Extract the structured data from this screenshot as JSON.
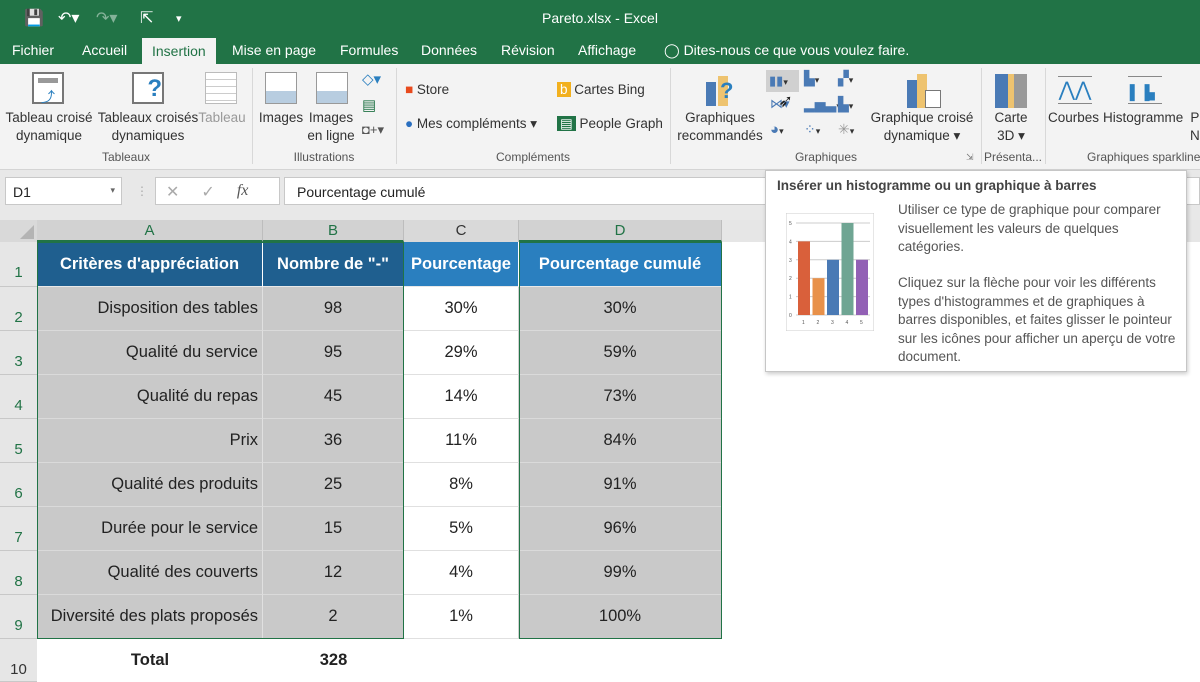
{
  "window": {
    "title": "Pareto.xlsx - Excel"
  },
  "quick_access": {
    "save": "save-icon",
    "undo": "undo-icon",
    "redo": "redo-icon",
    "pointer": "pointer-icon",
    "customize": "▾"
  },
  "tabs": [
    {
      "label": "Fichier"
    },
    {
      "label": "Accueil"
    },
    {
      "label": "Insertion",
      "active": true
    },
    {
      "label": "Mise en page"
    },
    {
      "label": "Formules"
    },
    {
      "label": "Données"
    },
    {
      "label": "Révision"
    },
    {
      "label": "Affichage"
    }
  ],
  "tell_me": "Dites-nous ce que vous voulez faire.",
  "ribbon": {
    "tableaux": {
      "group": "Tableaux",
      "b1": [
        "Tableau croisé",
        "dynamique"
      ],
      "b2": [
        "Tableaux croisés",
        "dynamiques"
      ],
      "b3": "Tableau"
    },
    "illustrations": {
      "group": "Illustrations",
      "b1": "Images",
      "b2": [
        "Images",
        "en ligne"
      ]
    },
    "complements": {
      "group": "Compléments",
      "store": "Store",
      "mes": "Mes compléments",
      "bing": "Cartes Bing",
      "people": "People Graph"
    },
    "graphiques": {
      "group": "Graphiques",
      "reco": [
        "Graphiques",
        "recommandés"
      ],
      "pivot": [
        "Graphique croisé",
        "dynamique ▾"
      ]
    },
    "presentation": {
      "group": "Présenta...",
      "carte": [
        "Carte",
        "3D ▾"
      ]
    },
    "sparkline": {
      "group": "Graphiques sparkline",
      "courbes": "Courbes",
      "histo": "Histogramme",
      "partial": [
        "P",
        "N"
      ]
    }
  },
  "formula_bar": {
    "name_box": "D1",
    "formula": "Pourcentage cumulé",
    "fx": "fx"
  },
  "columns": [
    "A",
    "B",
    "C",
    "D"
  ],
  "headers": [
    "Critères d'appréciation",
    "Nombre de \"-\"",
    "Pourcentage",
    "Pourcentage cumulé"
  ],
  "rows": [
    [
      "Disposition des tables",
      "98",
      "30%",
      "30%"
    ],
    [
      "Qualité du service",
      "95",
      "29%",
      "59%"
    ],
    [
      "Qualité du repas",
      "45",
      "14%",
      "73%"
    ],
    [
      "Prix",
      "36",
      "11%",
      "84%"
    ],
    [
      "Qualité des produits",
      "25",
      "8%",
      "91%"
    ],
    [
      "Durée pour le service",
      "15",
      "5%",
      "96%"
    ],
    [
      "Qualité des couverts",
      "12",
      "4%",
      "99%"
    ],
    [
      "Diversité des plats proposés",
      "2",
      "1%",
      "100%"
    ]
  ],
  "total": {
    "label": "Total",
    "value": "328"
  },
  "row_numbers": [
    "1",
    "2",
    "3",
    "4",
    "5",
    "6",
    "7",
    "8",
    "9",
    "10"
  ],
  "colors": {
    "green": "#217346",
    "header_dark": "#1f5f8f",
    "header_light": "#2a7fbf",
    "cell_gray": "#c9c9c9"
  },
  "tooltip": {
    "title": "Insérer un histogramme ou un graphique à barres",
    "p1": "Utiliser ce type de graphique pour comparer visuellement les valeurs de quelques catégories.",
    "p2": "Cliquez sur la flèche pour voir les différents types d'histogrammes et de graphiques à barres disponibles, et faites glisser le pointeur sur les icônes pour afficher un aperçu de votre document.",
    "preview": {
      "values": [
        4,
        2,
        3,
        5,
        3
      ],
      "categories": [
        "1",
        "2",
        "3",
        "4",
        "5"
      ],
      "ticks": [
        "0",
        "1",
        "2",
        "3",
        "4",
        "5"
      ],
      "colors": [
        "#d9603b",
        "#e8914a",
        "#4a7ab5",
        "#6fa593",
        "#9260b5"
      ]
    }
  }
}
